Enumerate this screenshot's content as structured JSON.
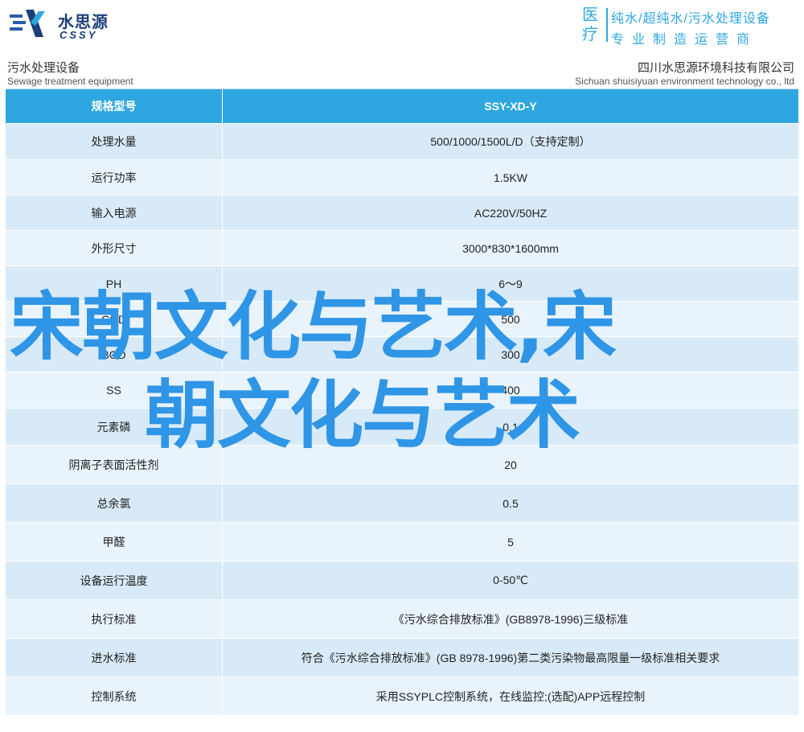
{
  "header": {
    "logo_cn": "水思源",
    "logo_en": "CSSY",
    "tag_big": "医疗",
    "tag_line1": "纯水/超纯水/污水处理设备",
    "tag_line2": "专业制造运营商"
  },
  "subheader": {
    "left_cn": "污水处理设备",
    "left_en": "Sewage treatment equipment",
    "right_cn": "四川水思源环境科技有限公司",
    "right_en": "Sichuan shuisiyuan environment technology co., ltd"
  },
  "table": {
    "head": {
      "label": "规格型号",
      "value": "SSY-XD-Y"
    },
    "rows": [
      {
        "label": "处理水量",
        "value": "500/1000/1500L/D（支持定制）"
      },
      {
        "label": "运行功率",
        "value": "1.5KW"
      },
      {
        "label": "输入电源",
        "value": "AC220V/50HZ"
      },
      {
        "label": "外形尺寸",
        "value": "3000*830*1600mm"
      },
      {
        "label": "PH",
        "value": "6～9"
      },
      {
        "label": "COD",
        "value": "500"
      },
      {
        "label": "BOD",
        "value": "300"
      },
      {
        "label": "SS",
        "value": "400"
      },
      {
        "label": "元素磷",
        "value": "0.1"
      },
      {
        "label": "阴离子表面活性剂",
        "value": "20"
      },
      {
        "label": "总余氯",
        "value": "0.5"
      },
      {
        "label": "甲醛",
        "value": "5"
      },
      {
        "label": "设备运行温度",
        "value": "0-50℃"
      },
      {
        "label": "执行标准",
        "value": "《污水综合排放标准》(GB8978-1996)三级标准"
      },
      {
        "label": "进水标准",
        "value": "符合《污水综合排放标准》(GB 8978-1996)第二类污染物最高限量一级标准相关要求"
      },
      {
        "label": "控制系统",
        "value": "采用SSYPLC控制系统，在线监控;(选配)APP远程控制"
      }
    ]
  },
  "overlay": {
    "line1": "宋朝文化与艺术,宋",
    "line2": "朝文化与艺术"
  },
  "colors": {
    "accent": "#2ea7e0",
    "row_odd": "#d8eaf7",
    "row_even": "#e9f3fb",
    "brand": "#1c3f7a",
    "overlay": "#2f95e6"
  }
}
